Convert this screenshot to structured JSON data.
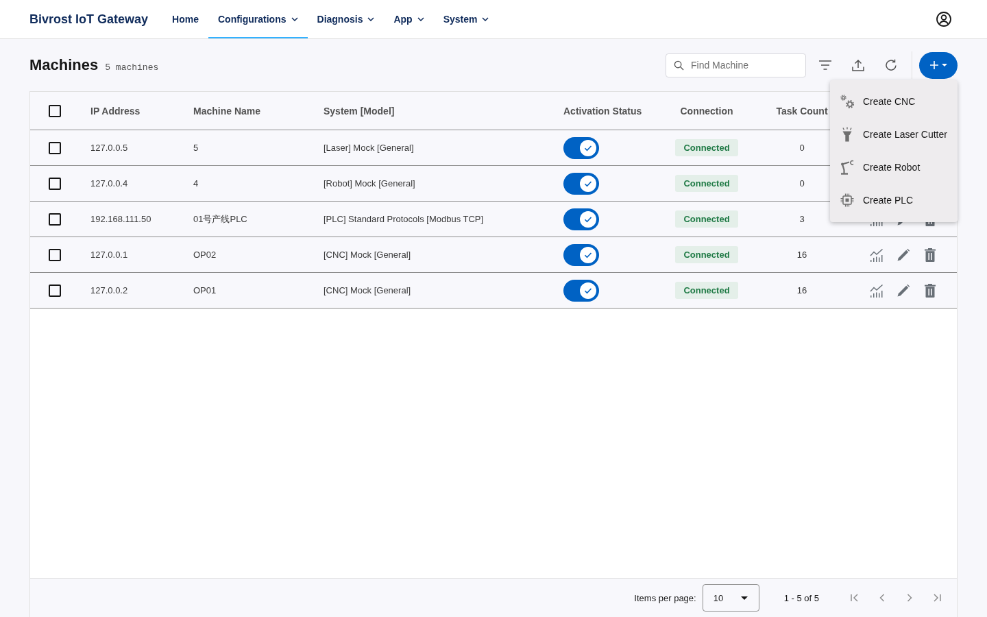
{
  "app_bar": {
    "title": "Bivrost IoT Gateway",
    "nav": [
      {
        "label": "Home",
        "kind": "link",
        "selected": false
      },
      {
        "label": "Configurations",
        "kind": "menu",
        "selected": true
      },
      {
        "label": "Diagnosis",
        "kind": "menu",
        "selected": false
      },
      {
        "label": "App",
        "kind": "menu",
        "selected": false
      },
      {
        "label": "System",
        "kind": "menu",
        "selected": false
      }
    ]
  },
  "page": {
    "title": "Machines",
    "count": "5 machines"
  },
  "toolbar": {
    "search": {
      "placeholder": "Find Machine"
    }
  },
  "add_menu": {
    "expanded": true,
    "items": [
      {
        "label": "Create CNC",
        "kind": "cnc"
      },
      {
        "label": "Create Laser Cutter",
        "kind": "laser"
      },
      {
        "label": "Create Robot",
        "kind": "robot"
      },
      {
        "label": "Create PLC",
        "kind": "plc"
      }
    ]
  },
  "table": {
    "header_checkbox": {
      "checked": false
    },
    "columns": [
      "IP Address",
      "Machine Name",
      "System [Model]",
      "Activation Status",
      "Connection",
      "Task Count"
    ],
    "rows": [
      {
        "selected": false,
        "ip": "127.0.0.5",
        "name": "5",
        "system": "[Laser] Mock [General]",
        "active": true,
        "connection": "Connected",
        "task_count": "0"
      },
      {
        "selected": false,
        "ip": "127.0.0.4",
        "name": "4",
        "system": "[Robot] Mock [General]",
        "active": true,
        "connection": "Connected",
        "task_count": "0"
      },
      {
        "selected": false,
        "ip": "192.168.111.50",
        "name": "01号产线PLC",
        "system": "[PLC] Standard Protocols [Modbus TCP]",
        "active": true,
        "connection": "Connected",
        "task_count": "3"
      },
      {
        "selected": false,
        "ip": "127.0.0.1",
        "name": "OP02",
        "system": "[CNC] Mock [General]",
        "active": true,
        "connection": "Connected",
        "task_count": "16"
      },
      {
        "selected": false,
        "ip": "127.0.0.2",
        "name": "OP01",
        "system": "[CNC] Mock [General]",
        "active": true,
        "connection": "Connected",
        "task_count": "16"
      }
    ]
  },
  "pagination": {
    "items_per_page_label": "Items per page:",
    "page_size": "10",
    "range": "1 - 5 of 5"
  }
}
